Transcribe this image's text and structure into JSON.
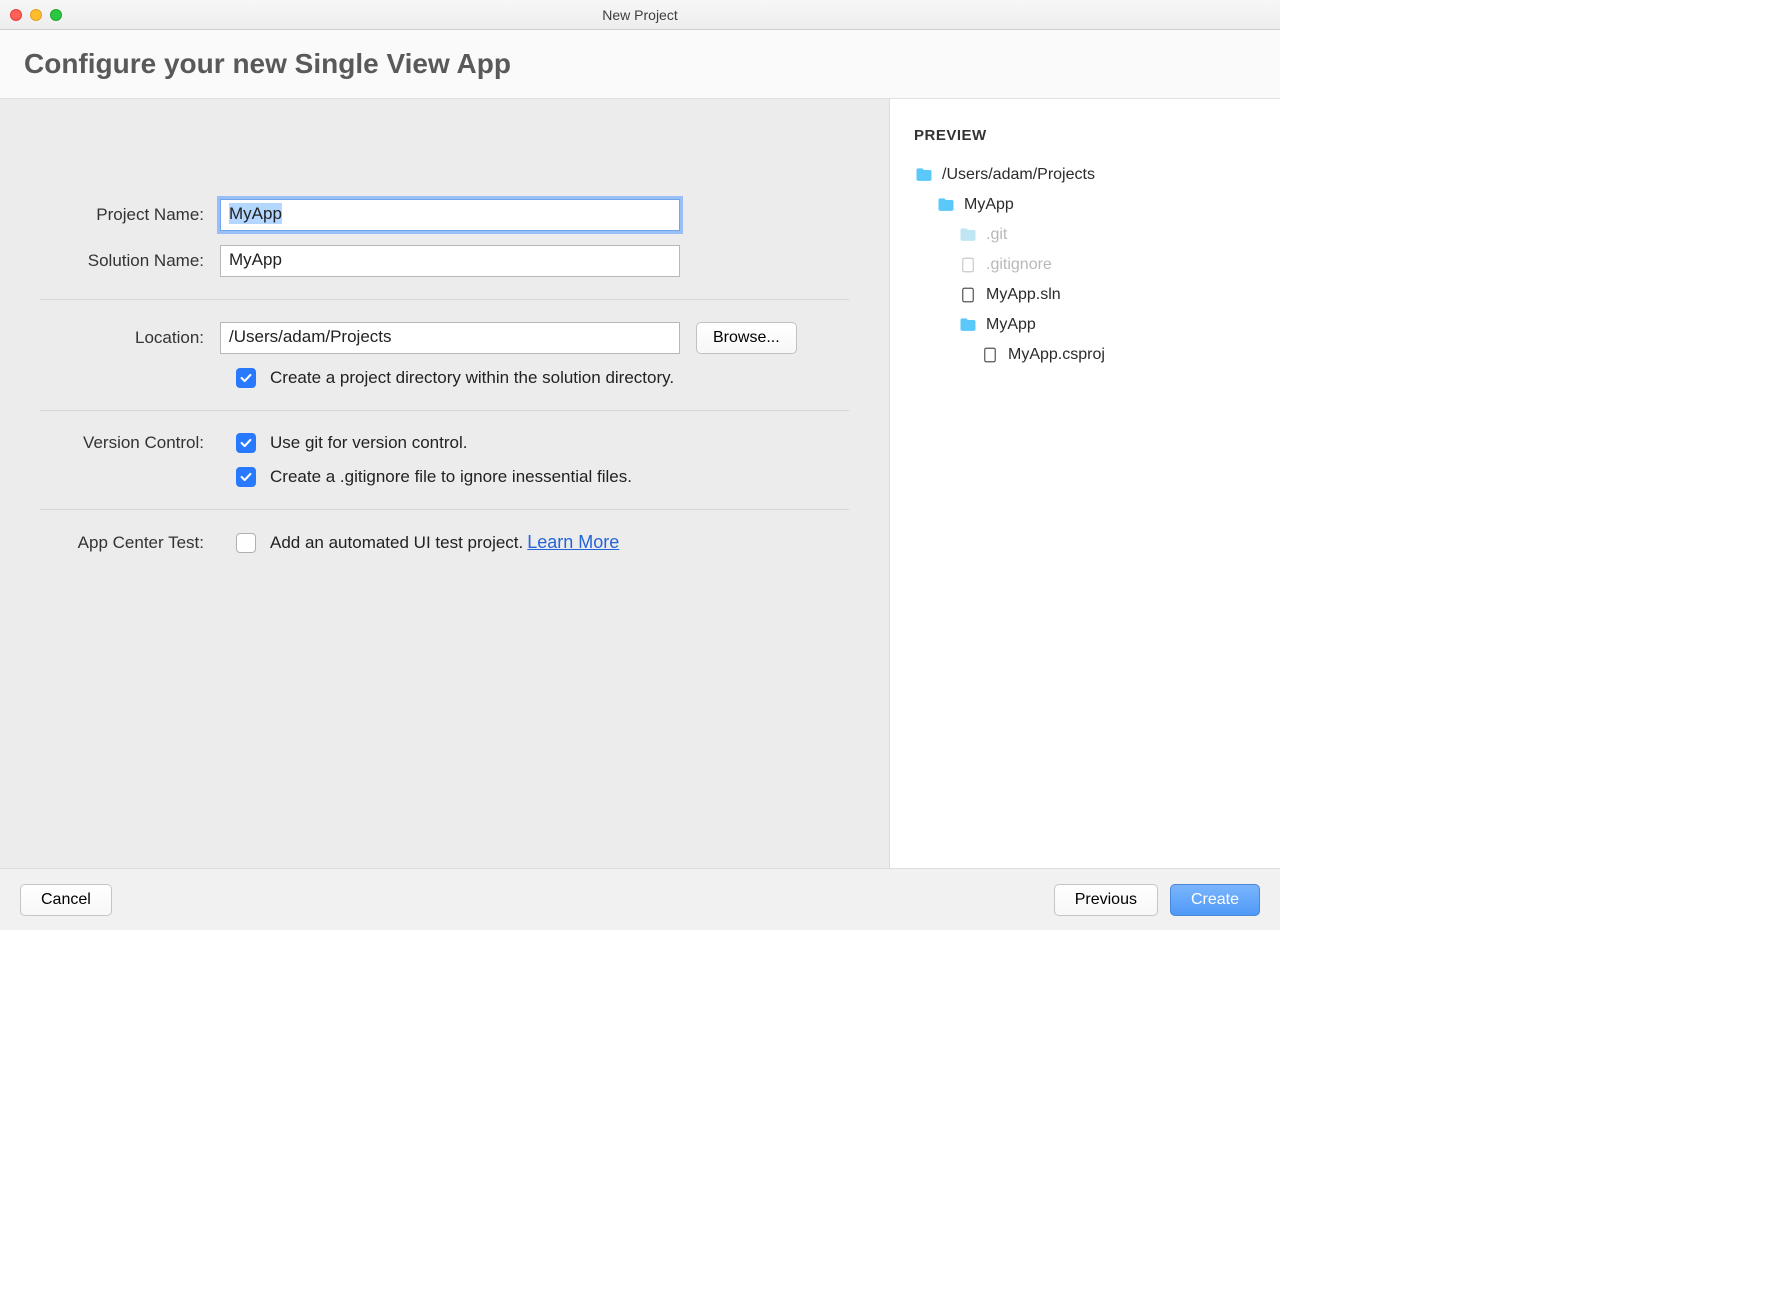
{
  "window": {
    "title": "New Project"
  },
  "header": {
    "title": "Configure your new Single View App"
  },
  "form": {
    "project_name_label": "Project Name:",
    "project_name_value": "MyApp",
    "solution_name_label": "Solution Name:",
    "solution_name_value": "MyApp",
    "location_label": "Location:",
    "location_value": "/Users/adam/Projects",
    "browse_label": "Browse...",
    "create_project_dir_label": "Create a project directory within the solution directory.",
    "version_control_label": "Version Control:",
    "use_git_label": "Use git for version control.",
    "create_gitignore_label": "Create a .gitignore file to ignore inessential files.",
    "app_center_label": "App Center Test:",
    "add_ui_test_label": "Add an automated UI test project.",
    "learn_more_label": "Learn More",
    "check_states": {
      "create_project_dir": true,
      "use_git": true,
      "create_gitignore": true,
      "add_ui_test": false
    }
  },
  "preview": {
    "title": "PREVIEW",
    "tree": {
      "root": "/Users/adam/Projects",
      "level1": "MyApp",
      "git": ".git",
      "gitignore": ".gitignore",
      "sln": "MyApp.sln",
      "level2": "MyApp",
      "csproj": "MyApp.csproj"
    }
  },
  "footer": {
    "cancel": "Cancel",
    "previous": "Previous",
    "create": "Create"
  },
  "colors": {
    "accent": "#2979ff",
    "folder": "#5ac8fa",
    "folder_dim": "#bfe6f2"
  }
}
